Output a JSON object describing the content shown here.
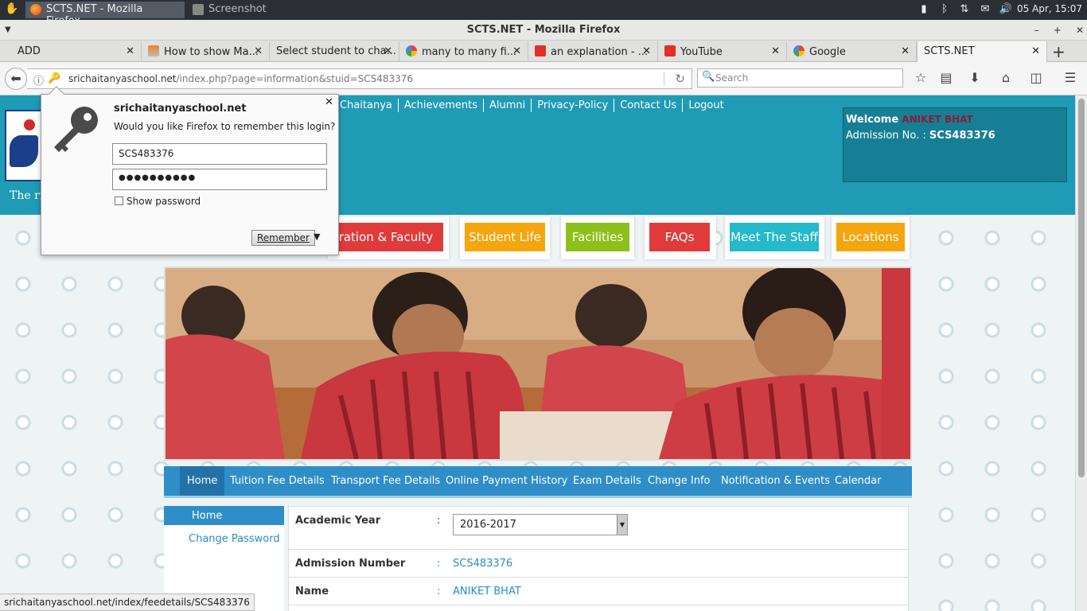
{
  "taskbar": {
    "firefox_task": "SCTS.NET - Mozilla Firefox",
    "screenshot_task": "Screenshot",
    "clock": "05 Apr, 15:07"
  },
  "window": {
    "title": "SCTS.NET - Mozilla Firefox"
  },
  "tabs": [
    {
      "label": "ADD",
      "icon": "none-icon"
    },
    {
      "label": "How to show Ma...",
      "icon": "stackoverflow-icon"
    },
    {
      "label": "Select student to cha...",
      "icon": "none-icon"
    },
    {
      "label": "many to many fi...",
      "icon": "google-icon"
    },
    {
      "label": "an explanation - ...",
      "icon": "youtube-icon"
    },
    {
      "label": "YouTube",
      "icon": "youtube-icon"
    },
    {
      "label": "Google",
      "icon": "google-icon"
    },
    {
      "label": "SCTS.NET",
      "icon": "none-icon"
    }
  ],
  "navbar": {
    "url_domain": "srichaitanyaschool.net",
    "url_path": "/index.php?page=information&stuid=SCS483376",
    "search_placeholder": "Search"
  },
  "site": {
    "tagline": "The rig",
    "topnav": [
      "Chaitanya",
      "Achievements",
      "Alumni",
      "Privacy-Policy",
      "Contact Us",
      "Logout"
    ],
    "welcome_label": "Welcome",
    "welcome_name": "ANIKET BHAT",
    "admission_label": "Admission No. :",
    "admission_no": "SCS483376",
    "pills": [
      {
        "label": "stration & Faculty",
        "color": "#e03b3b"
      },
      {
        "label": "Student Life",
        "color": "#f5a50d"
      },
      {
        "label": "Facilities",
        "color": "#8fbf1a"
      },
      {
        "label": "FAQs",
        "color": "#e03b3b"
      },
      {
        "label": "Meet The Staff",
        "color": "#25b9c9"
      },
      {
        "label": "Locations",
        "color": "#f5a50d"
      }
    ],
    "menu": [
      "Home",
      "Tuition Fee Details",
      "Transport Fee Details",
      "Online Payment History",
      "Exam Details",
      "Change Info",
      "Notification & Events",
      "Calendar"
    ],
    "sidebar": {
      "home": "Home",
      "change_password": "Change Password"
    },
    "info": {
      "academic_year_label": "Academic Year",
      "academic_year_value": "2016-2017",
      "admission_number_label": "Admission Number",
      "admission_number_value": "SCS483376",
      "name_label": "Name",
      "name_value": "ANIKET BHAT",
      "colon": ":"
    }
  },
  "status_url": "srichaitanyaschool.net/index/feedetails/SCS483376",
  "password_popup": {
    "domain": "srichaitanyaschool.net",
    "question": "Would you like Firefox to remember this login?",
    "username": "SCS483376",
    "password_mask": "●●●●●●●●●●",
    "show_password": "Show password",
    "remember_button": "Remember"
  },
  "colors": {
    "header": "#1f9bb5",
    "menu": "#2f8ec8",
    "link": "#2b8bc6"
  }
}
